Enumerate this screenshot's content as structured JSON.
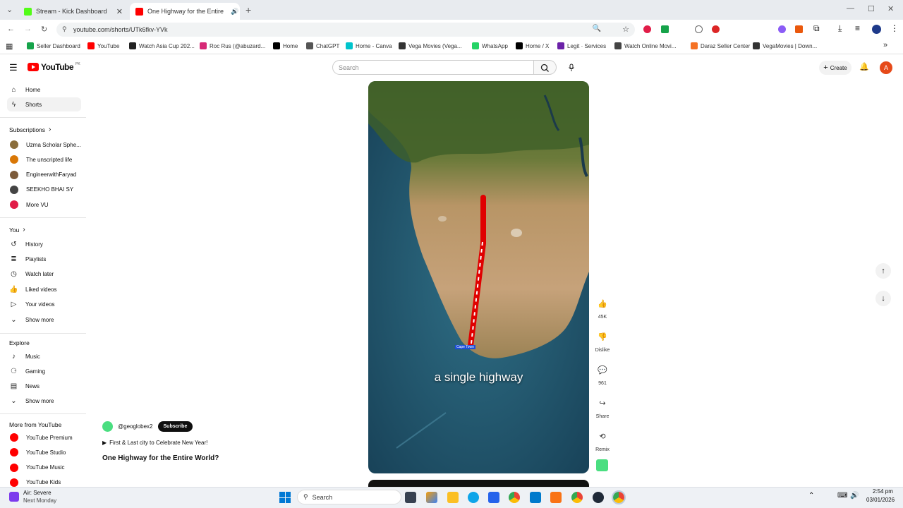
{
  "browser": {
    "tabs": [
      {
        "title": "Stream - Kick Dashboard",
        "active": false,
        "color": "#53fc18"
      },
      {
        "title": "One Highway for the Entire",
        "active": true,
        "color": "#ff0000"
      }
    ],
    "url": "youtube.com/shorts/UTk6fkv-YVk",
    "bookmarks": [
      {
        "label": "Seller Dashboard",
        "color": "#16a34a"
      },
      {
        "label": "YouTube",
        "color": "#ff0000"
      },
      {
        "label": "Watch Asia Cup 202...",
        "color": "#222222"
      },
      {
        "label": "Roc Rus (@abuzard...",
        "color": "#d62976"
      },
      {
        "label": "Home",
        "color": "#000000"
      },
      {
        "label": "ChatGPT",
        "color": "#555555"
      },
      {
        "label": "Home - Canva",
        "color": "#00c4cc"
      },
      {
        "label": "Vega Movies (Vega...",
        "color": "#333333"
      },
      {
        "label": "WhatsApp",
        "color": "#25d366"
      },
      {
        "label": "Home / X",
        "color": "#000000"
      },
      {
        "label": "Legit · Services",
        "color": "#6b21a8"
      },
      {
        "label": "Watch Online Movi...",
        "color": "#444444"
      },
      {
        "label": "Daraz Seller Center",
        "color": "#f57224"
      },
      {
        "label": "VegaMovies | Down...",
        "color": "#333333"
      }
    ]
  },
  "header": {
    "logo_text": "YouTube",
    "logo_sup": "PK",
    "search_placeholder": "Search",
    "create_label": "Create",
    "avatar_letter": "A"
  },
  "sidebar": {
    "main": [
      {
        "label": "Home",
        "icon": "home-icon"
      },
      {
        "label": "Shorts",
        "icon": "shorts-icon",
        "active": true
      }
    ],
    "subscriptions_title": "Subscriptions",
    "subscriptions": [
      {
        "label": "Uzma Scholar Sphe...",
        "color": "#8a6d3b"
      },
      {
        "label": "The unscripted life",
        "color": "#d97706"
      },
      {
        "label": "EngineerwithFaryad",
        "color": "#7c5b3a"
      },
      {
        "label": "SEEKHO BHAI SY",
        "color": "#444444"
      },
      {
        "label": "More VU",
        "color": "#e11d48"
      }
    ],
    "you_title": "You",
    "you": [
      {
        "label": "History",
        "icon": "history-icon"
      },
      {
        "label": "Playlists",
        "icon": "playlists-icon"
      },
      {
        "label": "Watch later",
        "icon": "watch-later-icon"
      },
      {
        "label": "Liked videos",
        "icon": "liked-videos-icon"
      },
      {
        "label": "Your videos",
        "icon": "your-videos-icon"
      },
      {
        "label": "Show more",
        "icon": "chevron-down-icon"
      }
    ],
    "explore_title": "Explore",
    "explore": [
      {
        "label": "Music",
        "icon": "music-icon"
      },
      {
        "label": "Gaming",
        "icon": "gaming-icon"
      },
      {
        "label": "News",
        "icon": "news-icon"
      },
      {
        "label": "Show more",
        "icon": "chevron-down-icon"
      }
    ],
    "more_title": "More from YouTube",
    "more": [
      {
        "label": "YouTube Premium"
      },
      {
        "label": "YouTube Studio"
      },
      {
        "label": "YouTube Music"
      },
      {
        "label": "YouTube Kids"
      }
    ]
  },
  "short": {
    "channel": "@geoglobex2",
    "subscribe_label": "Subscribe",
    "playlist_label": "First & Last city to Celebrate New Year!",
    "title": "One Highway for the Entire World?",
    "caption": "a single highway",
    "map_label": "Cape Town",
    "actions": {
      "likes": "45K",
      "dislike": "Dislike",
      "comments": "961",
      "share": "Share",
      "remix": "Remix"
    }
  },
  "taskbar": {
    "weather_title": "Air: Severe",
    "weather_sub": "Next Monday",
    "search_label": "Search",
    "time": "2:54 pm",
    "date": "03/01/2026"
  }
}
